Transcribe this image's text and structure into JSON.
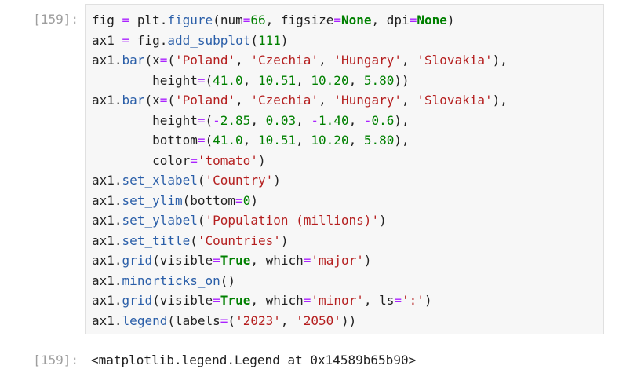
{
  "cell": {
    "input_prompt": "[159]:",
    "output_prompt": "[159]:",
    "code_lines": [
      [
        [
          "name",
          "fig"
        ],
        [
          "ws",
          " "
        ],
        [
          "op",
          "="
        ],
        [
          "ws",
          " "
        ],
        [
          "name",
          "plt"
        ],
        [
          "punc",
          "."
        ],
        [
          "attr",
          "figure"
        ],
        [
          "punc",
          "("
        ],
        [
          "name",
          "num"
        ],
        [
          "op",
          "="
        ],
        [
          "num",
          "66"
        ],
        [
          "punc",
          ","
        ],
        [
          "ws",
          " "
        ],
        [
          "name",
          "figsize"
        ],
        [
          "op",
          "="
        ],
        [
          "kw",
          "None"
        ],
        [
          "punc",
          ","
        ],
        [
          "ws",
          " "
        ],
        [
          "name",
          "dpi"
        ],
        [
          "op",
          "="
        ],
        [
          "kw",
          "None"
        ],
        [
          "punc",
          ")"
        ]
      ],
      [
        [
          "name",
          "ax1"
        ],
        [
          "ws",
          " "
        ],
        [
          "op",
          "="
        ],
        [
          "ws",
          " "
        ],
        [
          "name",
          "fig"
        ],
        [
          "punc",
          "."
        ],
        [
          "attr",
          "add_subplot"
        ],
        [
          "punc",
          "("
        ],
        [
          "num",
          "111"
        ],
        [
          "punc",
          ")"
        ]
      ],
      [
        [
          "name",
          "ax1"
        ],
        [
          "punc",
          "."
        ],
        [
          "attr",
          "bar"
        ],
        [
          "punc",
          "("
        ],
        [
          "name",
          "x"
        ],
        [
          "op",
          "="
        ],
        [
          "punc",
          "("
        ],
        [
          "str",
          "'Poland'"
        ],
        [
          "punc",
          ","
        ],
        [
          "ws",
          " "
        ],
        [
          "str",
          "'Czechia'"
        ],
        [
          "punc",
          ","
        ],
        [
          "ws",
          " "
        ],
        [
          "str",
          "'Hungary'"
        ],
        [
          "punc",
          ","
        ],
        [
          "ws",
          " "
        ],
        [
          "str",
          "'Slovakia'"
        ],
        [
          "punc",
          "),"
        ]
      ],
      [
        [
          "ws",
          "        "
        ],
        [
          "name",
          "height"
        ],
        [
          "op",
          "="
        ],
        [
          "punc",
          "("
        ],
        [
          "num",
          "41.0"
        ],
        [
          "punc",
          ","
        ],
        [
          "ws",
          " "
        ],
        [
          "num",
          "10.51"
        ],
        [
          "punc",
          ","
        ],
        [
          "ws",
          " "
        ],
        [
          "num",
          "10.20"
        ],
        [
          "punc",
          ","
        ],
        [
          "ws",
          " "
        ],
        [
          "num",
          "5.80"
        ],
        [
          "punc",
          "))"
        ]
      ],
      [
        [
          "name",
          "ax1"
        ],
        [
          "punc",
          "."
        ],
        [
          "attr",
          "bar"
        ],
        [
          "punc",
          "("
        ],
        [
          "name",
          "x"
        ],
        [
          "op",
          "="
        ],
        [
          "punc",
          "("
        ],
        [
          "str",
          "'Poland'"
        ],
        [
          "punc",
          ","
        ],
        [
          "ws",
          " "
        ],
        [
          "str",
          "'Czechia'"
        ],
        [
          "punc",
          ","
        ],
        [
          "ws",
          " "
        ],
        [
          "str",
          "'Hungary'"
        ],
        [
          "punc",
          ","
        ],
        [
          "ws",
          " "
        ],
        [
          "str",
          "'Slovakia'"
        ],
        [
          "punc",
          "),"
        ]
      ],
      [
        [
          "ws",
          "        "
        ],
        [
          "name",
          "height"
        ],
        [
          "op",
          "="
        ],
        [
          "punc",
          "("
        ],
        [
          "op",
          "-"
        ],
        [
          "num",
          "2.85"
        ],
        [
          "punc",
          ","
        ],
        [
          "ws",
          " "
        ],
        [
          "num",
          "0.03"
        ],
        [
          "punc",
          ","
        ],
        [
          "ws",
          " "
        ],
        [
          "op",
          "-"
        ],
        [
          "num",
          "1.40"
        ],
        [
          "punc",
          ","
        ],
        [
          "ws",
          " "
        ],
        [
          "op",
          "-"
        ],
        [
          "num",
          "0.6"
        ],
        [
          "punc",
          "),"
        ]
      ],
      [
        [
          "ws",
          "        "
        ],
        [
          "name",
          "bottom"
        ],
        [
          "op",
          "="
        ],
        [
          "punc",
          "("
        ],
        [
          "num",
          "41.0"
        ],
        [
          "punc",
          ","
        ],
        [
          "ws",
          " "
        ],
        [
          "num",
          "10.51"
        ],
        [
          "punc",
          ","
        ],
        [
          "ws",
          " "
        ],
        [
          "num",
          "10.20"
        ],
        [
          "punc",
          ","
        ],
        [
          "ws",
          " "
        ],
        [
          "num",
          "5.80"
        ],
        [
          "punc",
          "),"
        ]
      ],
      [
        [
          "ws",
          "        "
        ],
        [
          "name",
          "color"
        ],
        [
          "op",
          "="
        ],
        [
          "str",
          "'tomato'"
        ],
        [
          "punc",
          ")"
        ]
      ],
      [
        [
          "name",
          "ax1"
        ],
        [
          "punc",
          "."
        ],
        [
          "attr",
          "set_xlabel"
        ],
        [
          "punc",
          "("
        ],
        [
          "str",
          "'Country'"
        ],
        [
          "punc",
          ")"
        ]
      ],
      [
        [
          "name",
          "ax1"
        ],
        [
          "punc",
          "."
        ],
        [
          "attr",
          "set_ylim"
        ],
        [
          "punc",
          "("
        ],
        [
          "name",
          "bottom"
        ],
        [
          "op",
          "="
        ],
        [
          "num",
          "0"
        ],
        [
          "punc",
          ")"
        ]
      ],
      [
        [
          "name",
          "ax1"
        ],
        [
          "punc",
          "."
        ],
        [
          "attr",
          "set_ylabel"
        ],
        [
          "punc",
          "("
        ],
        [
          "str",
          "'Population (millions)'"
        ],
        [
          "punc",
          ")"
        ]
      ],
      [
        [
          "name",
          "ax1"
        ],
        [
          "punc",
          "."
        ],
        [
          "attr",
          "set_title"
        ],
        [
          "punc",
          "("
        ],
        [
          "str",
          "'Countries'"
        ],
        [
          "punc",
          ")"
        ]
      ],
      [
        [
          "name",
          "ax1"
        ],
        [
          "punc",
          "."
        ],
        [
          "attr",
          "grid"
        ],
        [
          "punc",
          "("
        ],
        [
          "name",
          "visible"
        ],
        [
          "op",
          "="
        ],
        [
          "kw",
          "True"
        ],
        [
          "punc",
          ","
        ],
        [
          "ws",
          " "
        ],
        [
          "name",
          "which"
        ],
        [
          "op",
          "="
        ],
        [
          "str",
          "'major'"
        ],
        [
          "punc",
          ")"
        ]
      ],
      [
        [
          "name",
          "ax1"
        ],
        [
          "punc",
          "."
        ],
        [
          "attr",
          "minorticks_on"
        ],
        [
          "punc",
          "()"
        ]
      ],
      [
        [
          "name",
          "ax1"
        ],
        [
          "punc",
          "."
        ],
        [
          "attr",
          "grid"
        ],
        [
          "punc",
          "("
        ],
        [
          "name",
          "visible"
        ],
        [
          "op",
          "="
        ],
        [
          "kw",
          "True"
        ],
        [
          "punc",
          ","
        ],
        [
          "ws",
          " "
        ],
        [
          "name",
          "which"
        ],
        [
          "op",
          "="
        ],
        [
          "str",
          "'minor'"
        ],
        [
          "punc",
          ","
        ],
        [
          "ws",
          " "
        ],
        [
          "name",
          "ls"
        ],
        [
          "op",
          "="
        ],
        [
          "str",
          "':'"
        ],
        [
          "punc",
          ")"
        ]
      ],
      [
        [
          "name",
          "ax1"
        ],
        [
          "punc",
          "."
        ],
        [
          "attr",
          "legend"
        ],
        [
          "punc",
          "("
        ],
        [
          "name",
          "labels"
        ],
        [
          "op",
          "="
        ],
        [
          "punc",
          "("
        ],
        [
          "str",
          "'2023'"
        ],
        [
          "punc",
          ","
        ],
        [
          "ws",
          " "
        ],
        [
          "str",
          "'2050'"
        ],
        [
          "punc",
          "))"
        ]
      ]
    ],
    "output_text": "<matplotlib.legend.Legend at 0x14589b65b90>"
  },
  "syntax_colors": {
    "operator": "#aa22ff",
    "attribute": "#2a5ea8",
    "string": "#b51f1f",
    "number": "#008000",
    "keyword": "#008000",
    "prompt": "#9e9e9e",
    "editor_background": "#f7f7f7"
  }
}
